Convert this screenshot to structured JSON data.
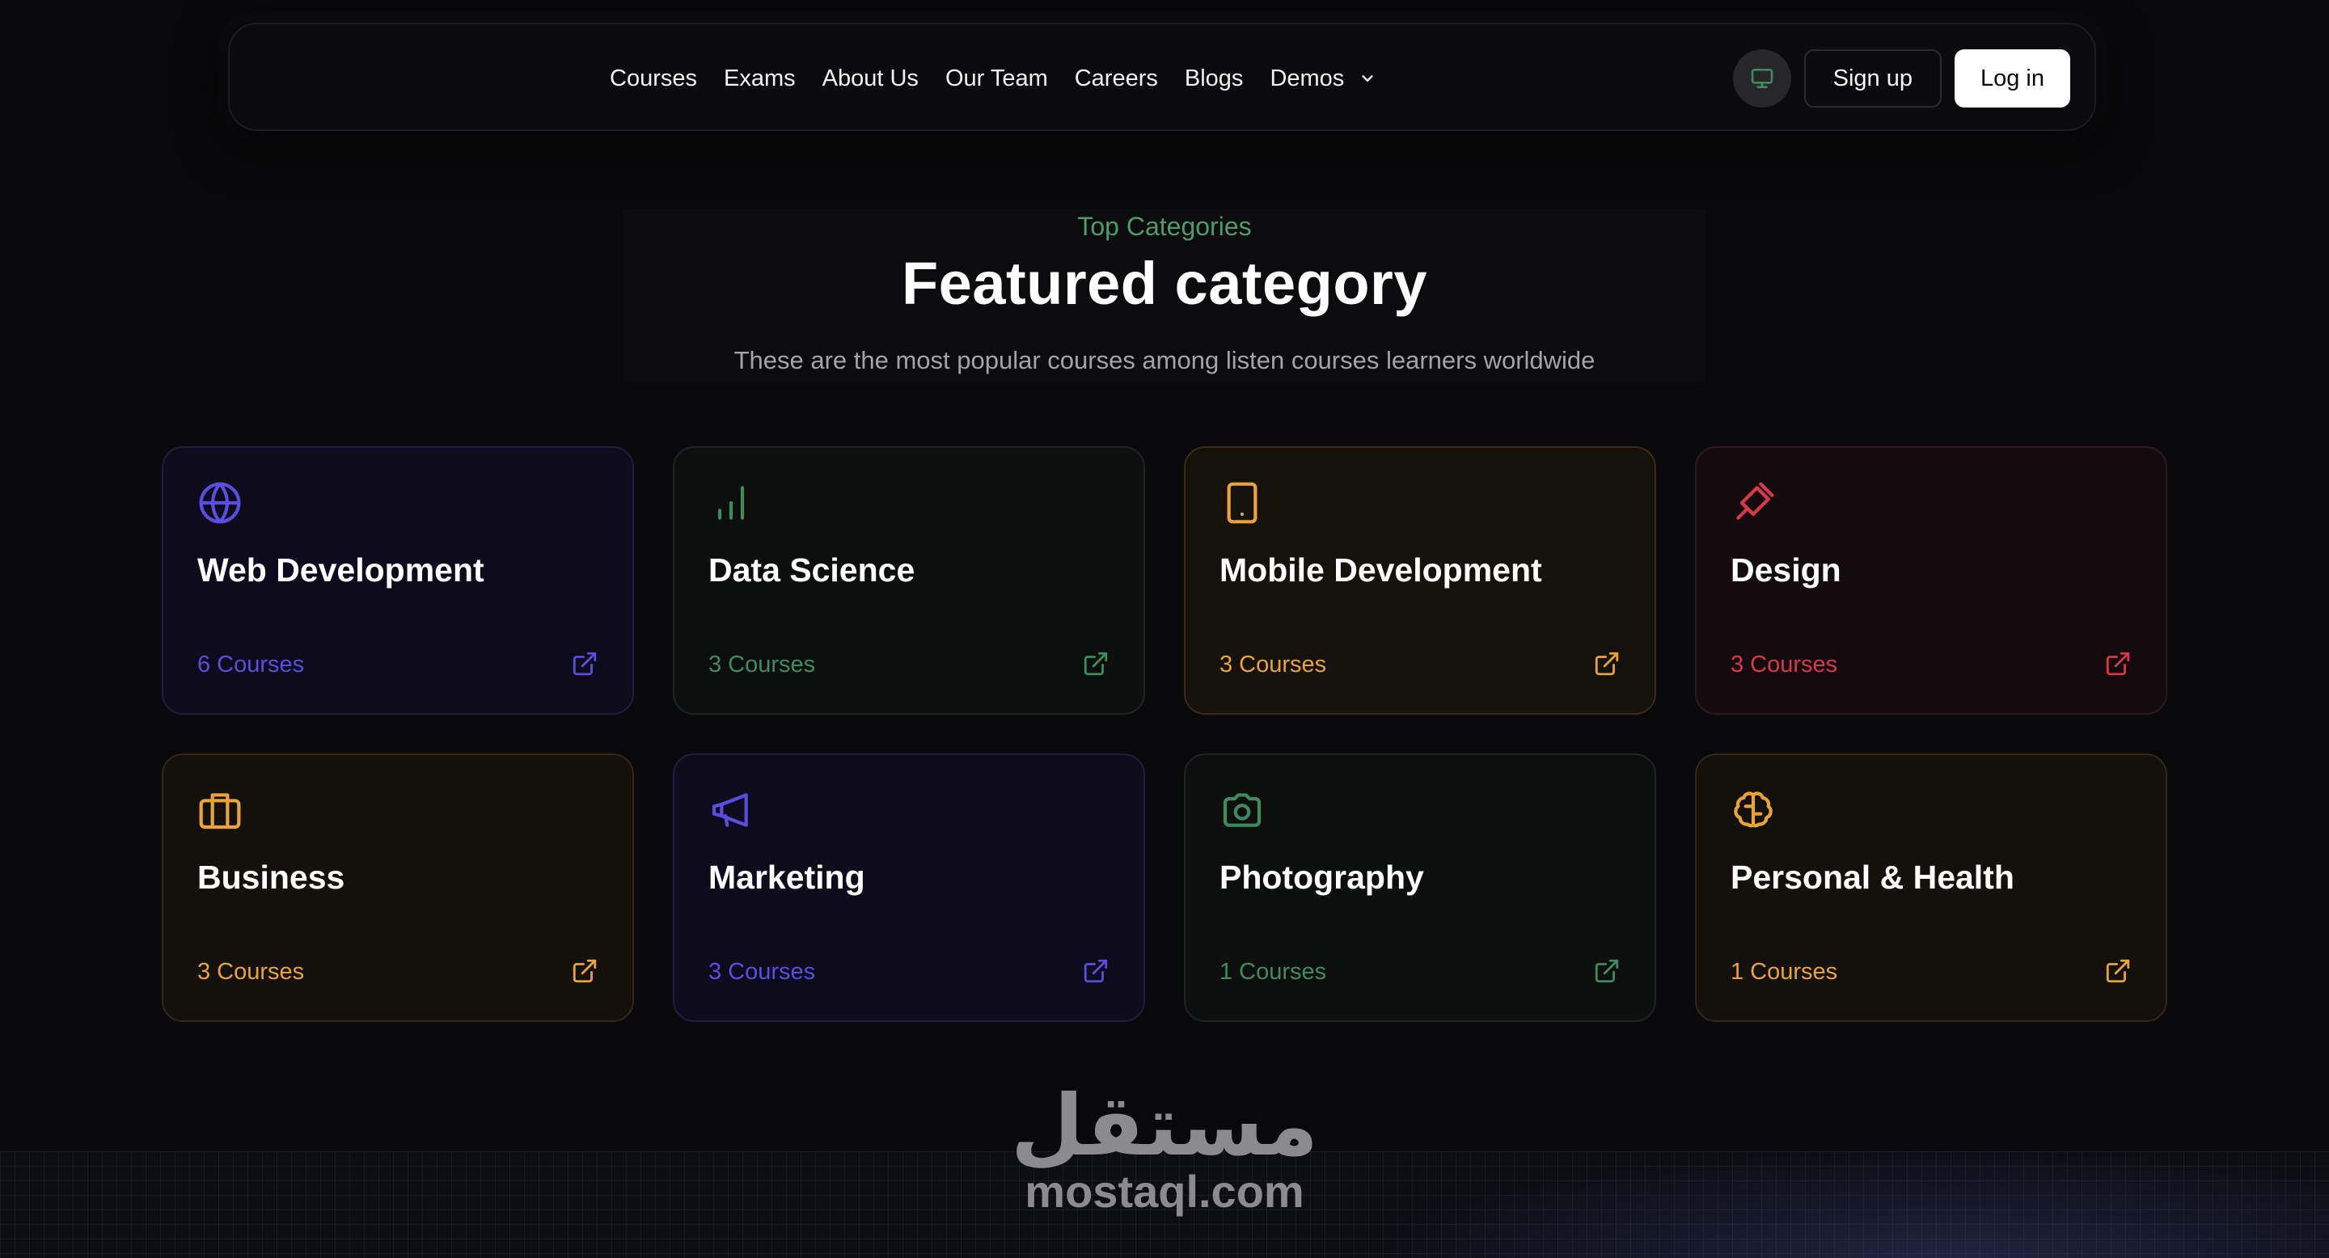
{
  "nav": {
    "links": [
      "Courses",
      "Exams",
      "About Us",
      "Our Team",
      "Careers",
      "Blogs",
      "Demos"
    ],
    "signup_label": "Sign up",
    "login_label": "Log in"
  },
  "section": {
    "eyebrow": "Top Categories",
    "title": "Featured category",
    "subtitle": "These are the most popular courses among listen courses learners worldwide"
  },
  "categories": [
    {
      "title": "Web Development",
      "count": "6 Courses",
      "icon": "globe-icon",
      "color": "#5b4de0"
    },
    {
      "title": "Data Science",
      "count": "3 Courses",
      "icon": "bar-chart-icon",
      "color": "#3f8a5f"
    },
    {
      "title": "Mobile Development",
      "count": "3 Courses",
      "icon": "tablet-icon",
      "color": "#e8a33a"
    },
    {
      "title": "Design",
      "count": "3 Courses",
      "icon": "paintbrush-icon",
      "color": "#d9384a"
    },
    {
      "title": "Business",
      "count": "3 Courses",
      "icon": "briefcase-icon",
      "color": "#e8a33a"
    },
    {
      "title": "Marketing",
      "count": "3 Courses",
      "icon": "megaphone-icon",
      "color": "#5b4de0"
    },
    {
      "title": "Photography",
      "count": "1 Courses",
      "icon": "camera-icon",
      "color": "#3f8a5f"
    },
    {
      "title": "Personal & Health",
      "count": "1 Courses",
      "icon": "brain-icon",
      "color": "#e8a33a"
    }
  ],
  "watermark": {
    "arabic": "مستقل",
    "latin": "mostaql.com"
  }
}
